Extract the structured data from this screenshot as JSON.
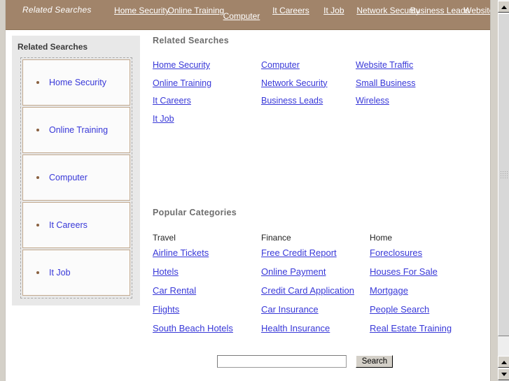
{
  "topnav": {
    "title": "Related Searches",
    "links": [
      {
        "label": "Home Security",
        "size": "wide"
      },
      {
        "label": "Online Training",
        "size": "wide"
      },
      {
        "label": "Computer",
        "size": "single"
      },
      {
        "label": "It Careers",
        "size": "mid"
      },
      {
        "label": "It Job",
        "size": "narrow"
      },
      {
        "label": "Network Security",
        "size": "wide"
      },
      {
        "label": "Business Leads",
        "size": "wide"
      },
      {
        "label": "Website Traffic",
        "size": "wide"
      }
    ]
  },
  "sidebar": {
    "title": "Related Searches",
    "items": [
      {
        "label": "Home Security"
      },
      {
        "label": "Online Training"
      },
      {
        "label": "Computer"
      },
      {
        "label": "It Careers"
      },
      {
        "label": "It Job"
      }
    ]
  },
  "main": {
    "related_searches": {
      "title": "Related Searches",
      "columns": [
        {
          "links": [
            "Home Security",
            "Online Training",
            "It Careers",
            "It Job"
          ]
        },
        {
          "links": [
            "Computer",
            "Network Security",
            "Business Leads"
          ]
        },
        {
          "links": [
            "Website Traffic",
            "Small Business",
            "Wireless"
          ]
        }
      ]
    },
    "popular_categories": {
      "title": "Popular Categories",
      "columns": [
        {
          "heading": "Travel",
          "links": [
            "Airline Tickets",
            "Hotels",
            "Car Rental",
            "Flights",
            "South Beach Hotels"
          ]
        },
        {
          "heading": "Finance",
          "links": [
            "Free Credit Report",
            "Online Payment",
            "Credit Card Application",
            "Car Insurance",
            "Health Insurance"
          ]
        },
        {
          "heading": "Home",
          "links": [
            "Foreclosures",
            "Houses For Sale",
            "Mortgage",
            "People Search",
            "Real Estate Training"
          ]
        }
      ]
    }
  },
  "search": {
    "value": "",
    "placeholder": "",
    "button_label": "Search"
  },
  "scrollbar": {
    "up_icon": "triangle-up-icon",
    "down_icon": "triangle-down-icon"
  },
  "colors": {
    "nav_background": "#a1846a",
    "nav_text": "#ffffff",
    "link": "#3838d8",
    "sidebar_background": "#e8e8e8",
    "sidebar_item_border": "#c2a98e",
    "bullet": "#8a6141",
    "section_title": "#6d6d6d",
    "chrome": "#d4d0c8"
  }
}
